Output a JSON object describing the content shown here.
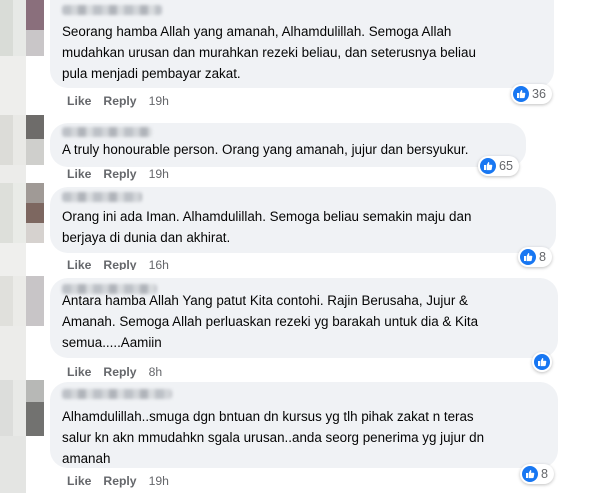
{
  "colors": {
    "accent": "#1877f2",
    "bubble": "#f0f2f5",
    "meta": "#65676b"
  },
  "comments": [
    {
      "text": "Seorang hamba Allah yang amanah, Alhamdulillah. Semoga Allah\nmudahkan urusan dan murahkan rezeki beliau, dan seterusnya beliau\npula menjadi pembayar zakat.",
      "like_label": "Like",
      "reply_label": "Reply",
      "time": "19h",
      "reaction_icon": "like-icon",
      "reaction_count": "36"
    },
    {
      "text": "A truly honourable person. Orang yang amanah, jujur dan bersyukur.",
      "like_label": "Like",
      "reply_label": "Reply",
      "time": "19h",
      "reaction_icon": "like-icon",
      "reaction_count": "65"
    },
    {
      "text": "Orang ini ada Iman. Alhamdulillah. Semoga beliau semakin maju dan\nberjaya di dunia dan akhirat.",
      "like_label": "Like",
      "reply_label": "Reply",
      "time": "16h",
      "reaction_icon": "like-icon",
      "reaction_count": "8"
    },
    {
      "text": "Antara hamba Allah Yang patut Kita contohi. Rajin Berusaha, Jujur &\nAmanah. Semoga Allah perluaskan rezeki yg barakah untuk dia & Kita\nsemua.....Aamiin",
      "like_label": "Like",
      "reply_label": "Reply",
      "time": "8h",
      "reaction_icon": "like-icon",
      "reaction_count": ""
    },
    {
      "text": "Alhamdulillah..smuga dgn bntuan dn kursus yg tlh pihak zakat n teras\nsalur kn akn mmudahkn sgala urusan..anda seorg penerima yg jujur dn\namanah",
      "like_label": "Like",
      "reply_label": "Reply",
      "time": "19h",
      "reaction_icon": "like-icon",
      "reaction_count": "8"
    }
  ]
}
